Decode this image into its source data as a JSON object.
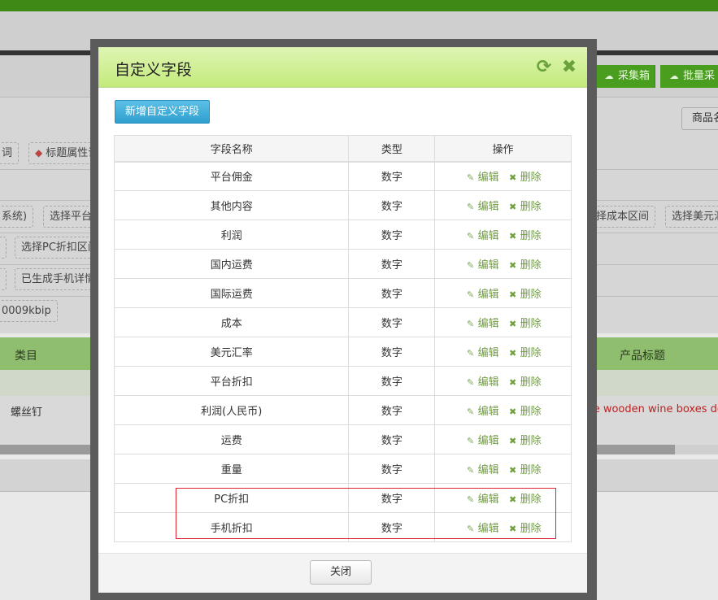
{
  "background": {
    "toolbar_buttons": [
      {
        "label": "采集箱",
        "icon": "cloud-download-icon"
      },
      {
        "label": "批量采",
        "icon": "cloud-download-icon"
      }
    ],
    "sort_button": "商品名",
    "tags_row1": [
      "词",
      "标题属性词"
    ],
    "tags_row2_left": [
      "系统)",
      "选择平台价"
    ],
    "tags_row2_right": [
      "选择成本区间",
      "选择美元汇"
    ],
    "tags_row3": [
      "选择PC折扣区间"
    ],
    "tags_row4": [
      "已生成手机详情"
    ],
    "tags_row5": [
      "0009kbip"
    ],
    "table_headers": [
      "类目",
      "产品标题"
    ],
    "row_category": "螺丝钉",
    "row_title": "ve wooden wine boxes doo"
  },
  "modal": {
    "title": "自定义字段",
    "refresh_icon": "refresh-icon",
    "close_icon": "close-icon",
    "add_button": "新增自定义字段",
    "columns": {
      "name": "字段名称",
      "type": "类型",
      "op": "操作"
    },
    "edit_label": "编辑",
    "delete_label": "删除",
    "rows": [
      {
        "name": "平台佣金",
        "type": "数字"
      },
      {
        "name": "其他内容",
        "type": "数字"
      },
      {
        "name": "利润",
        "type": "数字"
      },
      {
        "name": "国内运费",
        "type": "数字"
      },
      {
        "name": "国际运费",
        "type": "数字"
      },
      {
        "name": "成本",
        "type": "数字"
      },
      {
        "name": "美元汇率",
        "type": "数字"
      },
      {
        "name": "平台折扣",
        "type": "数字"
      },
      {
        "name": "利润(人民币)",
        "type": "数字"
      },
      {
        "name": "运费",
        "type": "数字"
      },
      {
        "name": "重量",
        "type": "数字"
      },
      {
        "name": "PC折扣",
        "type": "数字"
      },
      {
        "name": "手机折扣",
        "type": "数字"
      }
    ],
    "close_button": "关闭"
  },
  "colors": {
    "accent_green": "#c3ea7c",
    "action_green": "#6f9e3c",
    "primary_blue": "#2f9fcf",
    "highlight_red": "#d22233"
  }
}
